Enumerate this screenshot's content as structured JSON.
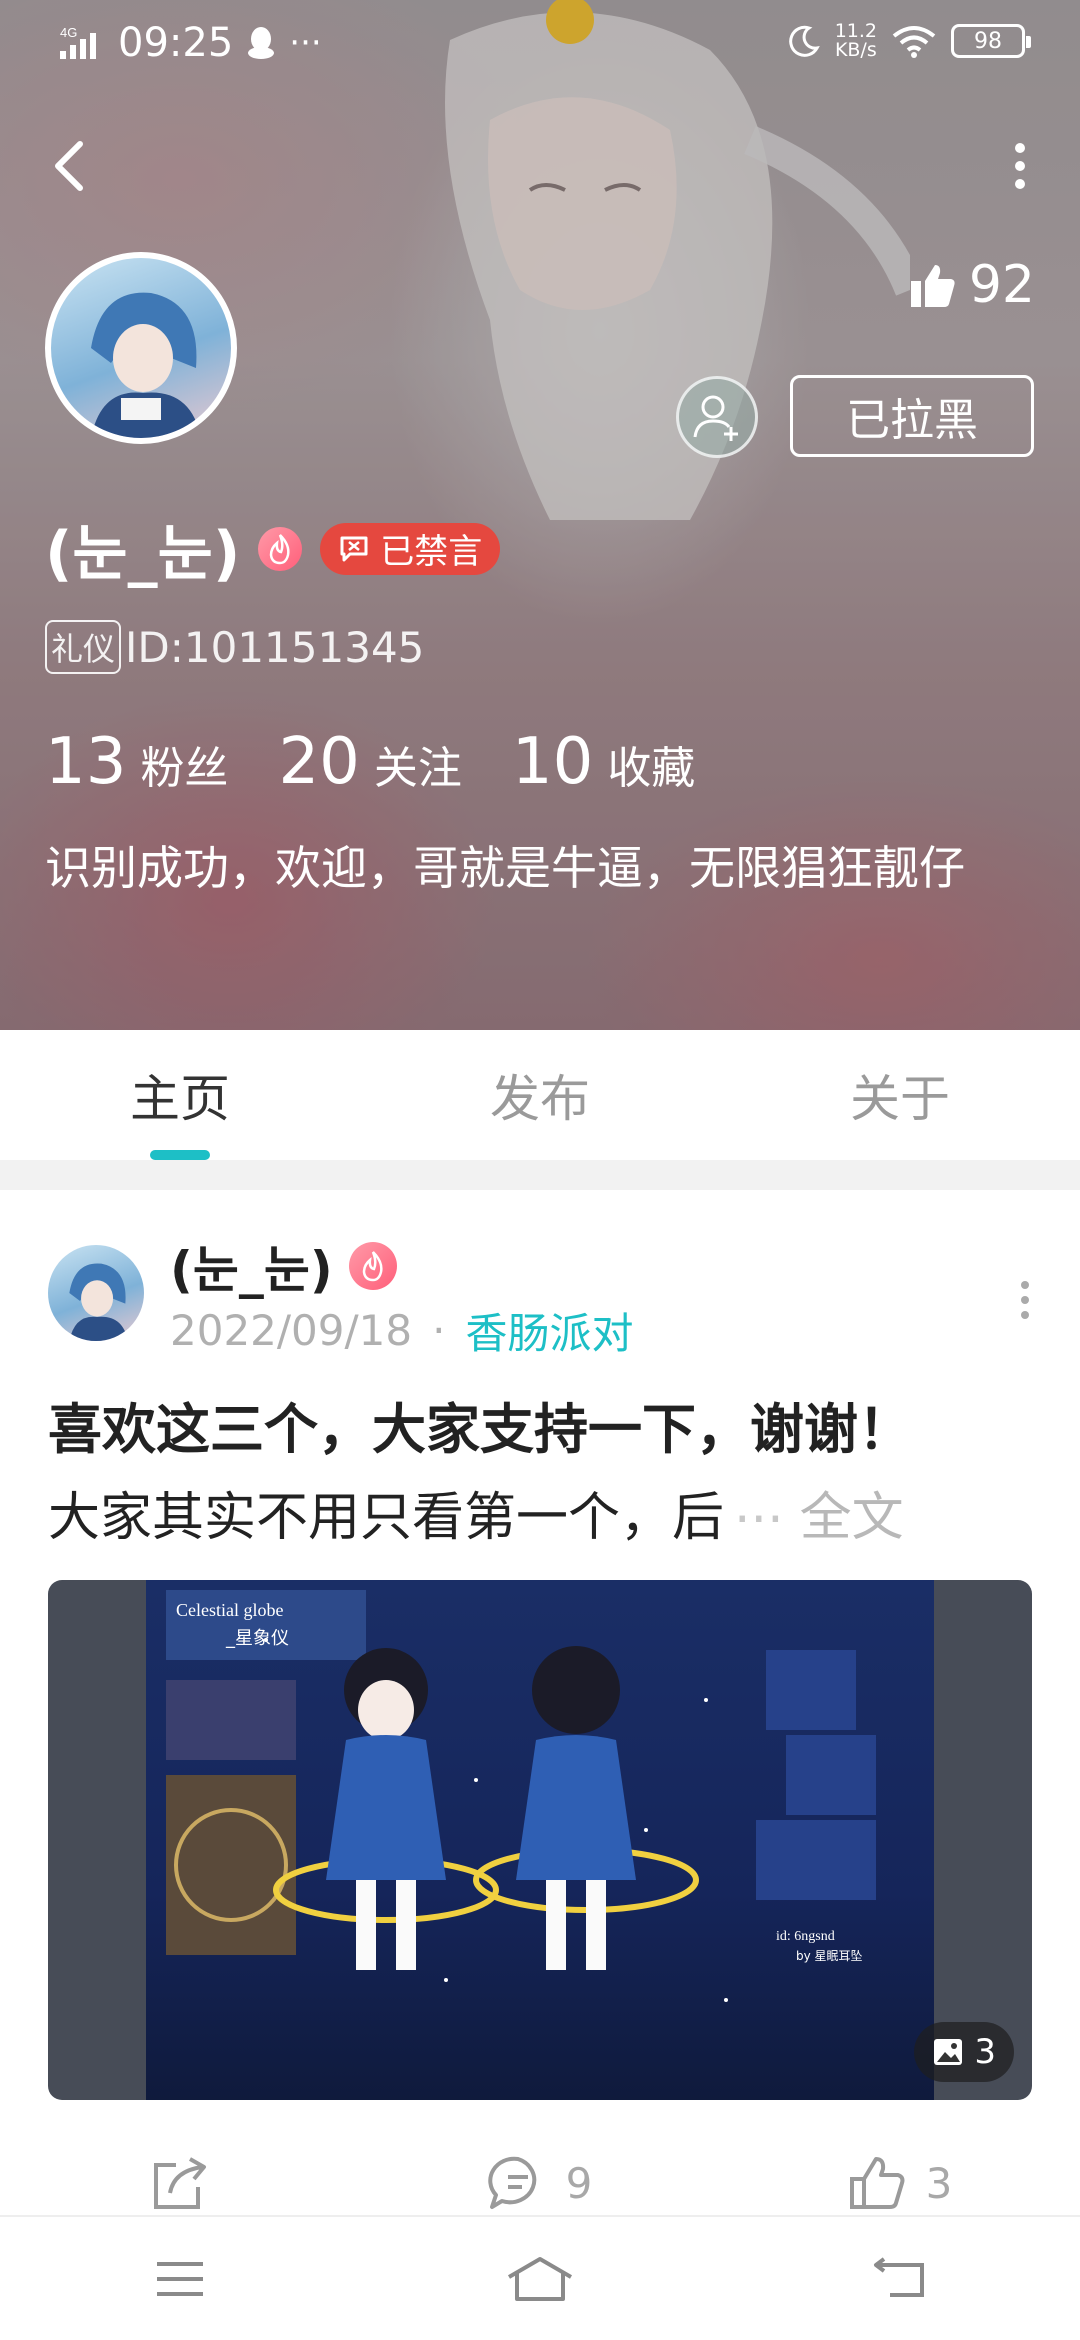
{
  "status_bar": {
    "network": "4G",
    "time": "09:25",
    "more": "···",
    "speed_value": "11.2",
    "speed_unit": "KB/s",
    "battery": "98"
  },
  "profile": {
    "likes": "92",
    "blocked_label": "已拉黑",
    "username": "(눈_눈)",
    "muted_label": "已禁言",
    "etiquette_tag": "礼仪",
    "id_text": "ID:101151345",
    "stats": [
      {
        "value": "13",
        "label": "粉丝"
      },
      {
        "value": "20",
        "label": "关注"
      },
      {
        "value": "10",
        "label": "收藏"
      }
    ],
    "bio": "识别成功，欢迎，哥就是牛逼，无限猖狂靓仔"
  },
  "tabs": [
    {
      "label": "主页",
      "active": true
    },
    {
      "label": "发布",
      "active": false
    },
    {
      "label": "关于",
      "active": false
    }
  ],
  "post": {
    "author": "(눈_눈)",
    "date": "2022/09/18",
    "separator": "·",
    "topic": "香肠派对",
    "title": "喜欢这三个，大家支持一下，谢谢！",
    "body": "大家其实不用只看第一个，后",
    "ellipsis": "...",
    "full_text_label": "全文",
    "image_count": "3",
    "image_caption_en": "Celestial globe",
    "image_caption_cn": "_星象仪",
    "image_credit_id": "id: 6ngsnd",
    "image_credit_by": "by 星眠耳坠",
    "comments": "9",
    "likes": "3"
  },
  "colors": {
    "accent": "#1dbfc6",
    "muted_badge": "#e5483f",
    "text_dark": "#222222",
    "text_grey": "#9a9a9a"
  }
}
